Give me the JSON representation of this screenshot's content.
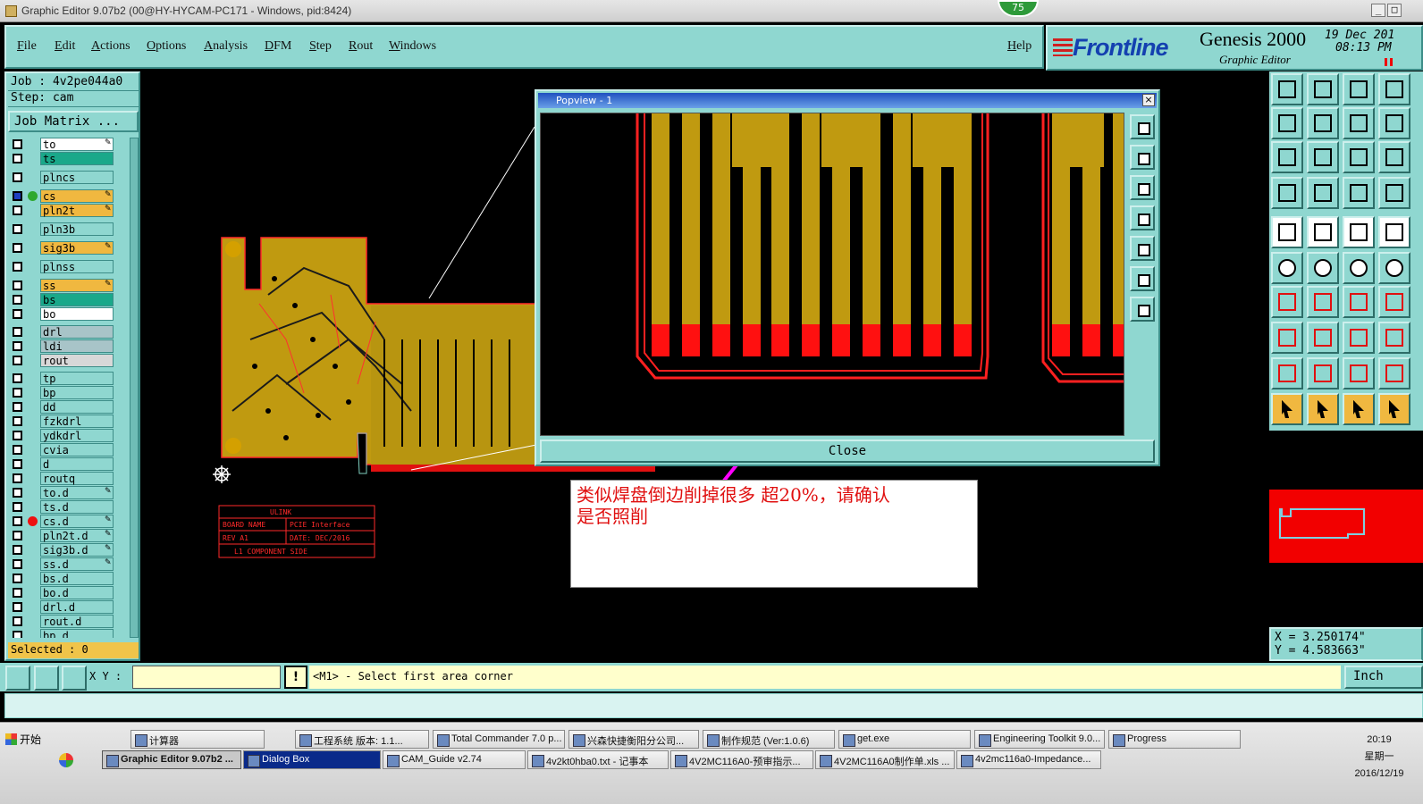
{
  "window": {
    "title": "Graphic Editor 9.07b2 (00@HY-HYCAM-PC171 - Windows, pid:8424)",
    "badge": "75",
    "minimize": "_",
    "restore": "□"
  },
  "menu": {
    "items": [
      "File",
      "Edit",
      "Actions",
      "Options",
      "Analysis",
      "DFM",
      "Step",
      "Rout",
      "Windows"
    ],
    "help": "Help"
  },
  "brand": {
    "logo": "Frontline",
    "product": "Genesis 2000",
    "subtitle": "Graphic Editor",
    "date": "19 Dec 201",
    "time": "08:13 PM"
  },
  "job": {
    "job_line": "Job : 4v2pe044a0",
    "step_line": "Step: cam",
    "matrix_button": "Job Matrix ...",
    "selected": "Selected : 0"
  },
  "layers": [
    {
      "name": "to",
      "color": "#ffffff",
      "pen": true
    },
    {
      "name": "ts",
      "color": "#1aa88a",
      "pen": false
    },
    {
      "name": "plncs",
      "color": "#8fd7d0",
      "pen": false
    },
    {
      "name": "cs",
      "color": "#f0b840",
      "pen": true,
      "dot": "#2fa82f",
      "checked": true
    },
    {
      "name": "pln2t",
      "color": "#f0b840",
      "pen": true
    },
    {
      "name": "pln3b",
      "color": "#8fd7d0",
      "pen": false
    },
    {
      "name": "sig3b",
      "color": "#f0b840",
      "pen": true
    },
    {
      "name": "plnss",
      "color": "#8fd7d0",
      "pen": false
    },
    {
      "name": "ss",
      "color": "#f0b840",
      "pen": true
    },
    {
      "name": "bs",
      "color": "#1aa88a",
      "pen": false
    },
    {
      "name": "bo",
      "color": "#ffffff",
      "pen": false
    },
    {
      "name": "drl",
      "color": "#a8c4c8",
      "pen": false
    },
    {
      "name": "ldi",
      "color": "#a8c4c8",
      "pen": false
    },
    {
      "name": "rout",
      "color": "#d8d8d8",
      "pen": false
    },
    {
      "name": "tp",
      "color": "#8fd7d0",
      "pen": false
    },
    {
      "name": "bp",
      "color": "#8fd7d0",
      "pen": false
    },
    {
      "name": "dd",
      "color": "#8fd7d0",
      "pen": false
    },
    {
      "name": "fzkdrl",
      "color": "#8fd7d0",
      "pen": false
    },
    {
      "name": "ydkdrl",
      "color": "#8fd7d0",
      "pen": false
    },
    {
      "name": "cvia",
      "color": "#8fd7d0",
      "pen": false
    },
    {
      "name": "d",
      "color": "#8fd7d0",
      "pen": false
    },
    {
      "name": "routq",
      "color": "#8fd7d0",
      "pen": false
    },
    {
      "name": "to.d",
      "color": "#8fd7d0",
      "pen": true
    },
    {
      "name": "ts.d",
      "color": "#8fd7d0",
      "pen": false
    },
    {
      "name": "cs.d",
      "color": "#8fd7d0",
      "pen": true,
      "dot": "#ee1111"
    },
    {
      "name": "pln2t.d",
      "color": "#8fd7d0",
      "pen": true
    },
    {
      "name": "sig3b.d",
      "color": "#8fd7d0",
      "pen": true
    },
    {
      "name": "ss.d",
      "color": "#8fd7d0",
      "pen": true
    },
    {
      "name": "bs.d",
      "color": "#8fd7d0",
      "pen": false
    },
    {
      "name": "bo.d",
      "color": "#8fd7d0",
      "pen": false
    },
    {
      "name": "drl.d",
      "color": "#8fd7d0",
      "pen": false
    },
    {
      "name": "rout.d",
      "color": "#8fd7d0",
      "pen": false
    },
    {
      "name": "bp.d",
      "color": "#8fd7d0",
      "pen": false
    }
  ],
  "board_label": {
    "line1": "ULINK",
    "line2a": "BOARD NAME",
    "line2b": "PCIE Interface",
    "line3a": "REV A1",
    "line3b": "DATE: DEC/2016",
    "line4": "L1 COMPONENT SIDE"
  },
  "popview": {
    "title": "Popview - 1",
    "close_x": "×",
    "close_button": "Close"
  },
  "annotation": {
    "line1": "类似焊盘倒边削掉很多   超20%，请确认",
    "line2": "是否照削"
  },
  "coords": {
    "x": "X = 3.250174\"",
    "y": "Y = 4.583663\""
  },
  "bottom": {
    "xy_label": "X Y :",
    "xy_value": "",
    "warn": "!",
    "prompt": "<M1> - Select first area corner",
    "unit": "Inch"
  },
  "taskbar": {
    "start": "开始",
    "row1": [
      "计算器",
      "工程系统  版本: 1.1...",
      "Total Commander 7.0 p...",
      "兴森快捷衡阳分公司...",
      "制作规范 (Ver:1.0.6)",
      "get.exe",
      "Engineering Toolkit 9.0...",
      "Progress"
    ],
    "row2": [
      "Graphic Editor 9.07b2 ...",
      "Dialog Box",
      "CAM_Guide v2.74",
      "4v2kt0hba0.txt - 记事本",
      "4V2MC116A0-预审指示...",
      "4V2MC116A0制作单.xls ...",
      "4v2mc116a0-Impedance..."
    ],
    "clock_time": "20:19",
    "clock_day": "星期一",
    "clock_date": "2016/12/19"
  },
  "colors": {
    "panel": "#8fd7d0",
    "copper": "#c09a10",
    "outline": "#ff1a1a",
    "annotation_text": "#e01010",
    "arrow": "#ff00ff"
  }
}
